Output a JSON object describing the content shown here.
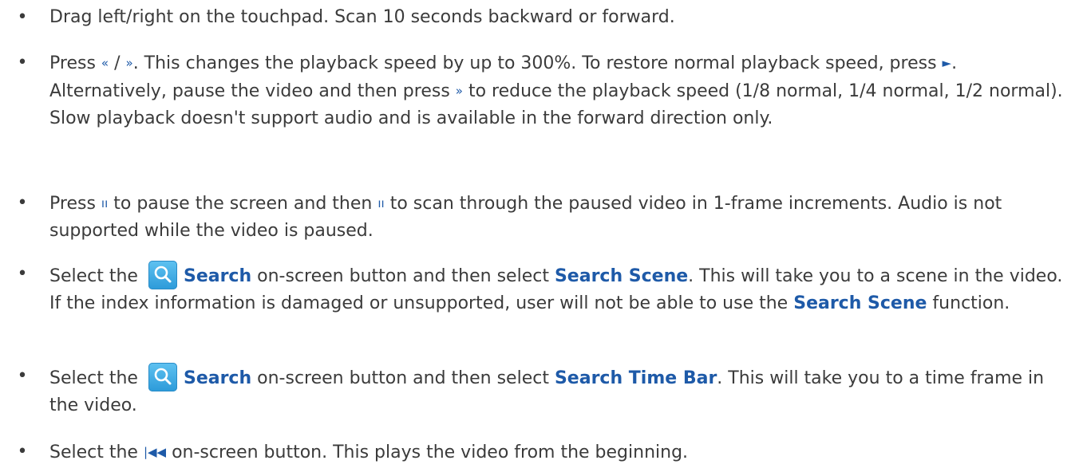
{
  "bullet_char": "•",
  "icons": {
    "rewind": "«",
    "fast_forward": "»",
    "play": "►",
    "pause": "ıı",
    "skip_back": "|◀◀",
    "search": "magnifier-in-blue-box"
  },
  "accent_color": "#1e5aa8",
  "items": [
    {
      "text": "Drag left/right on the touchpad. Scan 10 seconds backward or forward."
    },
    {
      "p1": "Press ",
      "p2": " / ",
      "p3": ". This changes the playback speed by up to 300%. To restore normal playback speed, press ",
      "p4": ". Alternatively, pause the video and then press ",
      "p5": " to reduce the playback speed (1/8 normal, 1/4 normal, 1/2 normal). Slow playback doesn't support audio and is available in the forward direction only."
    },
    {
      "p1": "Press ",
      "p2": " to pause the screen and then ",
      "p3": " to scan through the paused video in 1-frame increments. Audio is not supported while the video is paused."
    },
    {
      "p1": "Select the ",
      "b1": "Search",
      "p2": " on-screen button and then select ",
      "b2": "Search Scene",
      "p3": ". This will take you to a scene in the video. If the index information is damaged or unsupported, user will not be able to use the ",
      "b3": "Search Scene",
      "p4": " function."
    },
    {
      "p1": "Select the ",
      "b1": "Search",
      "p2": " on-screen button and then select ",
      "b2": "Search Time Bar",
      "p3": ". This will take you to a time frame in the video."
    },
    {
      "p1": "Select the ",
      "p2": " on-screen button. This plays the video from the beginning."
    }
  ]
}
